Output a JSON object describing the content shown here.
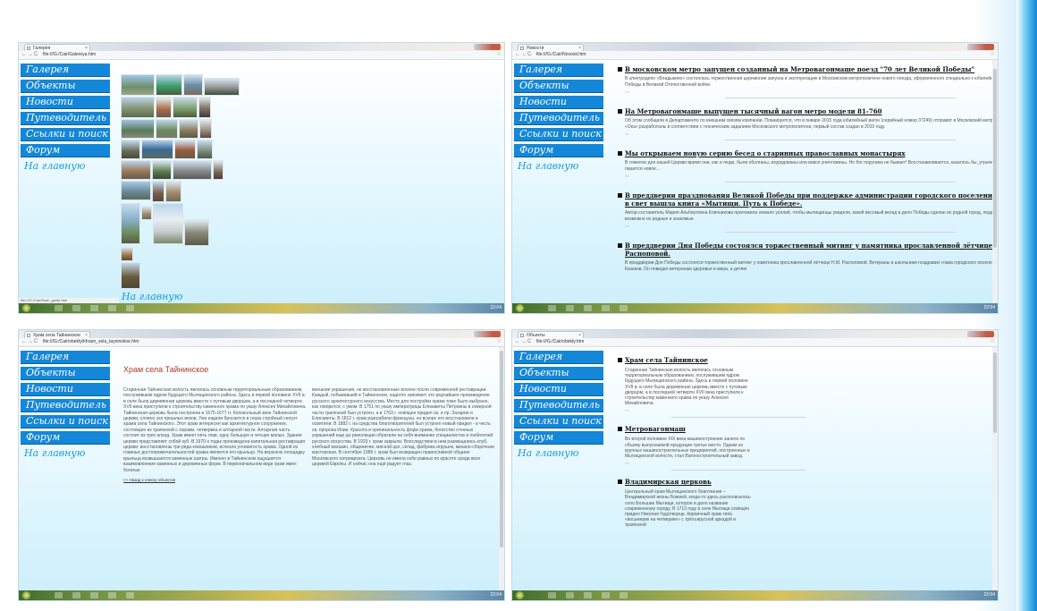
{
  "sidebar": {
    "items": [
      {
        "label": "Галерея"
      },
      {
        "label": "Объекты"
      },
      {
        "label": "Новости"
      },
      {
        "label": "Путеводитель"
      },
      {
        "label": "Ссылки и поиск"
      },
      {
        "label": "Форум"
      }
    ],
    "home": "На главную"
  },
  "windows": {
    "gallery": {
      "tab": "Галерея",
      "url": "file:///G:/Cair/Galereya.htm",
      "status": "file:///G:/Cair/Scan_guide.htm",
      "bottom_link": "На главную"
    },
    "news": {
      "tab": "Новости",
      "url": "file:///G:/Cair/Novosti.htm",
      "items": [
        {
          "title": "В московском метро запущен созданный на Метровагонмаше поезд \"70 лет Великой Победы\"",
          "text": "В электродепо «Владыкино» состоялась торжественная церемония запуска в эксплуатацию в Московском метрополитене нового поезда, оформленного специально к юбилейному 70-летию Победы в Великой Отечественной войне."
        },
        {
          "title": "На Метровагонмаше выпущен тысячный вагон метро модели 81-760",
          "text": "Об этом сообщили в Департаменте по внешним связям компании. Планируется, что в январе 2015 года юбилейный вагон (серийный номер 37249) отправят в Московский метрополитен. Вагоны «Ока» разработаны в соответствии с техническим заданием Московского метрополитена; первый состав создан в 2010 году."
        },
        {
          "title": "Мы открываем новую серию бесед о старинных православных монастырях",
          "text": "В тяжелое для нашей Церкви время они, как и люди, были оболганы, изуродованы или вовсе уничтожены. Но бог поругаем не бывает! Восстанавливается, казалось бы, утраченное, строится и пишется новое..."
        },
        {
          "title": "В преддверии празднования Великой Победы при поддержке администрации городского поселения Мытищи в свет вышла книга «Мытищи. Путь к Победе».",
          "text": "Автор-составитель Мария Альбертовна Кличникова приложила немало усилий, чтобы мытищинцы увидели, какой весомый вклад в дело Победы сделан их родной город, люди, живущие рядом, возможно их родные и знакомые."
        },
        {
          "title": "В преддверии Дня Победы состоялся торжественный митинг у памятника прославленной лётчице Н.М. Распоповой.",
          "text": "В преддверии Дня Победы состоялся торжественный митинг у памятника прославленной лётчице Н.М. Распоповой. Ветераны и школьники поздравил глава городского поселения Мытищи А.М. Казаков. Он поведал ветеранам здоровья и мира, а детям"
        }
      ],
      "more": "<<"
    },
    "article": {
      "tab": "Храм села Тайнинское",
      "url": "file:///G:/Cair/obekty/khram_sela_tayninskoe.htm",
      "title": "Храм села Тайнинское",
      "col1": "Старинная Тайнинская волость являлась основным территориальным образованием, послужившим ядром будущего Мытищинского района. Здесь в первой половине XVII в. в селе была деревянная церковь вместе с путевым дворцом, а в последней четверти XVII века приступили к строительству каменного храма по указу Алексея Михайловича. Тайнинская церковь была построена в 1675-1677 гг. Колокольный звон Тайнинской церкви, словно эхо прошлых веков. Уже издали бросается в глаза стройный силуэт храма села Тайнинского. Этот храм интересен как архитектурное сооружение, состоящее из трапезной с хорами, четверика и алтарной части. Алтарная часть состоит из трех апсид. Храм имеет пять глав, одну большую и четыре малых. Здание церкви представляет собой куб. В 1970-х годах произведена капитальная реставрация церкви: восстановлены три ряда кокошников, исчезла угловатость храма. Одной из главных достопримечательностей храма является его крыльцо. На верхнюю площадку крыльца возвышаются каменные шатры. Именно в Тайнинском ощущается взаимовлияние каменных и деревянных форм. В первоначальном виде храм имел богатые",
      "col2": "внешние украшения, не восстановленные вполне после современной реставрации. Каждый, побывавший в Тайнинском, надолго запомнит это редчайшее произведение русского архитектурного искусства. Место для постройки храма тоже было выбрано, как говорится, с умом. В 1751 по указу императрицы Елизаветы Петровны в северной части трапезной был устроен, а в 1763 г. освящен придел св. и пр. Захария и Елисаветы. В 1812 г. храм разграбили французы, но вскоре его восстановили и освятили. В 1882 г. на средства благотворителей был устроен новый придел - в честь св. пророка Илии. Красота и оригинальность форм храма, богатство стенных украшений еще до революции обратили на себя внимание специалистов и любителей русского искусства. В 1929 г. храм закрыли. Впоследствии в нем размещались клуб, хлебный магазин, общежитие, мясной цех, склад, фабрика игрушек, механо-сборочная мастерская. В сентябре 1989 г. храм был возвращен православной общине Московского патриархата. Церковь не имела себе равных по красоте среди всех церквей Европы. И сейчас она ещё радует глаз.",
      "back": "<< Назад к списку объектов"
    },
    "objects": {
      "tab": "Объекты",
      "url": "file:///G:/Cair/obekty.htm",
      "items": [
        {
          "title": "Храм села Тайнинское",
          "text": "Старинная Тайнинская волость являлась основным территориальным образованием, послужившим ядром будущего Мытищинского района. Здесь в первой половине XVII в. в селе была деревянная церковь вместе с путевым дворцом, а в последней четверти XVII века приступили к строительству каменного храма по указу Алексея Михайловича."
        },
        {
          "title": "Метровагонмаш",
          "text": "Во второй половине XIX века машиностроение заняло по объему выпускаемой продукции третье место. Одним из крупных машиностроительных предприятий, построенных в Мытищинской волости, стал Вагоностроительный завод."
        },
        {
          "title": "Владимирская церковь",
          "text": "Центральный храм Мытищинского благочиния – Владимирской иконы Божией, когда-то здесь располагалось село Большие Мытищи, которое и дало название современному городу. В 1713 году в селе Мытищи освящён придел Николая Чудотворца. Кирпичный храм типа «восьмерик на четверике» с трёхъярусной аркадой и трапезной"
        }
      ],
      "more": "<<"
    },
    "clock": "22:04"
  },
  "colors": {
    "accent": "#1487d8",
    "link": "#1a9ad4",
    "article_title": "#b23a2a"
  },
  "icons": [
    "back-icon",
    "forward-icon",
    "reload-icon",
    "page-icon",
    "star-icon",
    "close-icon",
    "start-orb-icon"
  ]
}
